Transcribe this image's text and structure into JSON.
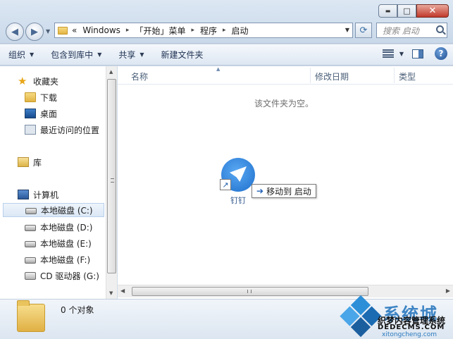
{
  "window": {
    "minimize_glyph": "▬",
    "maximize_glyph": "□",
    "close_glyph": "✕"
  },
  "address_bar": {
    "chevrons": "«",
    "crumbs": [
      "Windows",
      "「开始」菜单",
      "程序",
      "启动"
    ],
    "separator": "▸"
  },
  "search": {
    "placeholder": "搜索 启动"
  },
  "toolbar": {
    "organize": "组织",
    "include_in_library": "包含到库中",
    "share": "共享",
    "new_folder": "新建文件夹"
  },
  "sidebar": {
    "favorites": "收藏夹",
    "downloads": "下载",
    "desktop": "桌面",
    "recent": "最近访问的位置",
    "libraries": "库",
    "computer": "计算机",
    "drives": [
      "本地磁盘 (C:)",
      "本地磁盘 (D:)",
      "本地磁盘 (E:)",
      "本地磁盘 (F:)",
      "CD 驱动器 (G:)"
    ]
  },
  "columns": {
    "name": "名称",
    "modified": "修改日期",
    "type": "类型"
  },
  "content": {
    "empty_message": "该文件夹为空。",
    "drag_item_label": "钉钉",
    "move_tip": "移动到 启动"
  },
  "details": {
    "object_count": "0 个对象"
  },
  "watermark": {
    "brand_big": "系统城",
    "line1": "织梦内容管理系统",
    "line2": "DEDECMS.COM",
    "line3": "xitongcheng.com"
  },
  "colors": {
    "accent": "#2b79bf",
    "chrome_bg": "#dce7f3",
    "close_red": "#c0392b"
  }
}
